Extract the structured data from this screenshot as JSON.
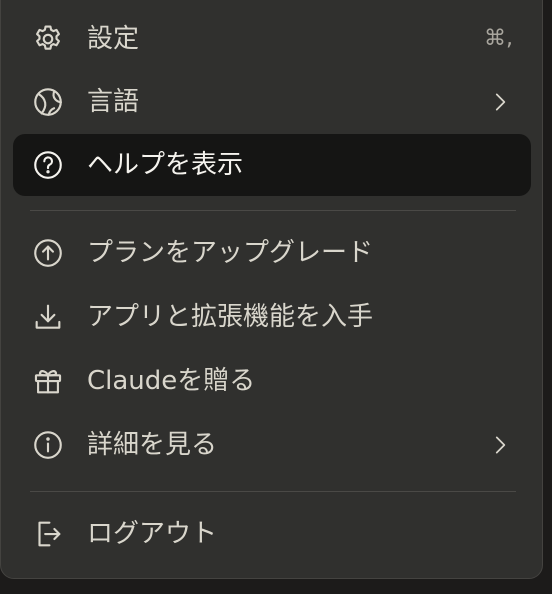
{
  "menu": {
    "items": [
      {
        "label": "設定",
        "icon": "gear-icon",
        "shortcut": "⌘,"
      },
      {
        "label": "言語",
        "icon": "globe-icon",
        "submenu": true
      },
      {
        "label": "ヘルプを表示",
        "icon": "help-circle-icon",
        "active": true
      },
      {
        "label": "プランをアップグレード",
        "icon": "upgrade-arrow-icon"
      },
      {
        "label": "アプリと拡張機能を入手",
        "icon": "download-icon"
      },
      {
        "label": "Claudeを贈る",
        "icon": "gift-icon"
      },
      {
        "label": "詳細を見る",
        "icon": "info-icon",
        "submenu": true
      },
      {
        "label": "ログアウト",
        "icon": "logout-icon"
      }
    ]
  },
  "colors": {
    "menu_background": "#30302e",
    "active_background": "#151514",
    "text": "#d9d6cc",
    "icon": "#d9d6cc",
    "divider": "#4a4946"
  }
}
